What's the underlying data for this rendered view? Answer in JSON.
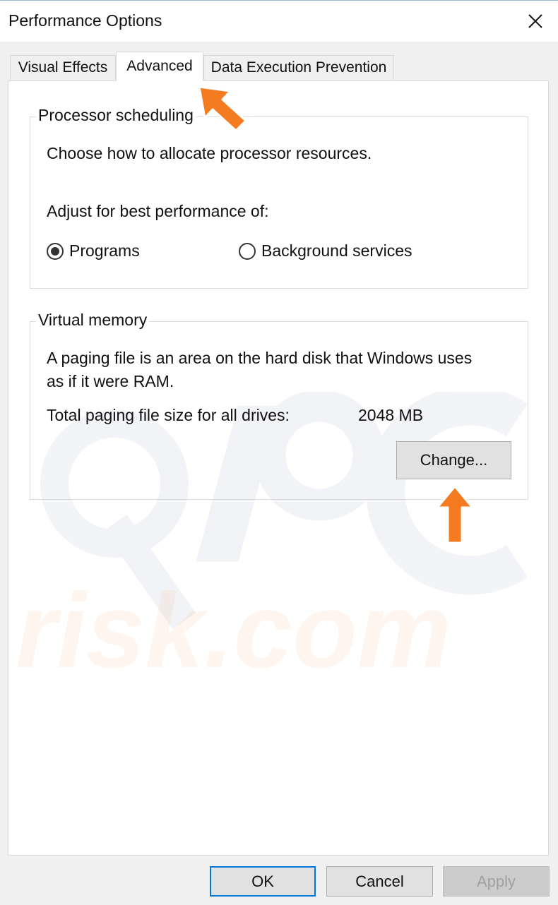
{
  "window": {
    "title": "Performance Options"
  },
  "tabs": [
    {
      "label": "Visual Effects",
      "active": false
    },
    {
      "label": "Advanced",
      "active": true
    },
    {
      "label": "Data Execution Prevention",
      "active": false
    }
  ],
  "processor_scheduling": {
    "title": "Processor scheduling",
    "description": "Choose how to allocate processor resources.",
    "adjust_label": "Adjust for best performance of:",
    "options": [
      {
        "label": "Programs",
        "selected": true
      },
      {
        "label": "Background services",
        "selected": false
      }
    ]
  },
  "virtual_memory": {
    "title": "Virtual memory",
    "description_line1": "A paging file is an area on the hard disk that Windows uses",
    "description_line2": "as if it were RAM.",
    "total_label": "Total paging file size for all drives:",
    "total_value": "2048 MB",
    "change_label": "Change..."
  },
  "footer": {
    "ok_label": "OK",
    "cancel_label": "Cancel",
    "apply_label": "Apply",
    "apply_disabled": true
  },
  "colors": {
    "annotation_arrow": "#f47b20",
    "focus_border": "#0078d7"
  },
  "icons": {
    "close": "close-icon",
    "annotation": "annotation-arrow"
  },
  "watermark": {
    "logo_text": "PC",
    "text": "risk.com"
  }
}
